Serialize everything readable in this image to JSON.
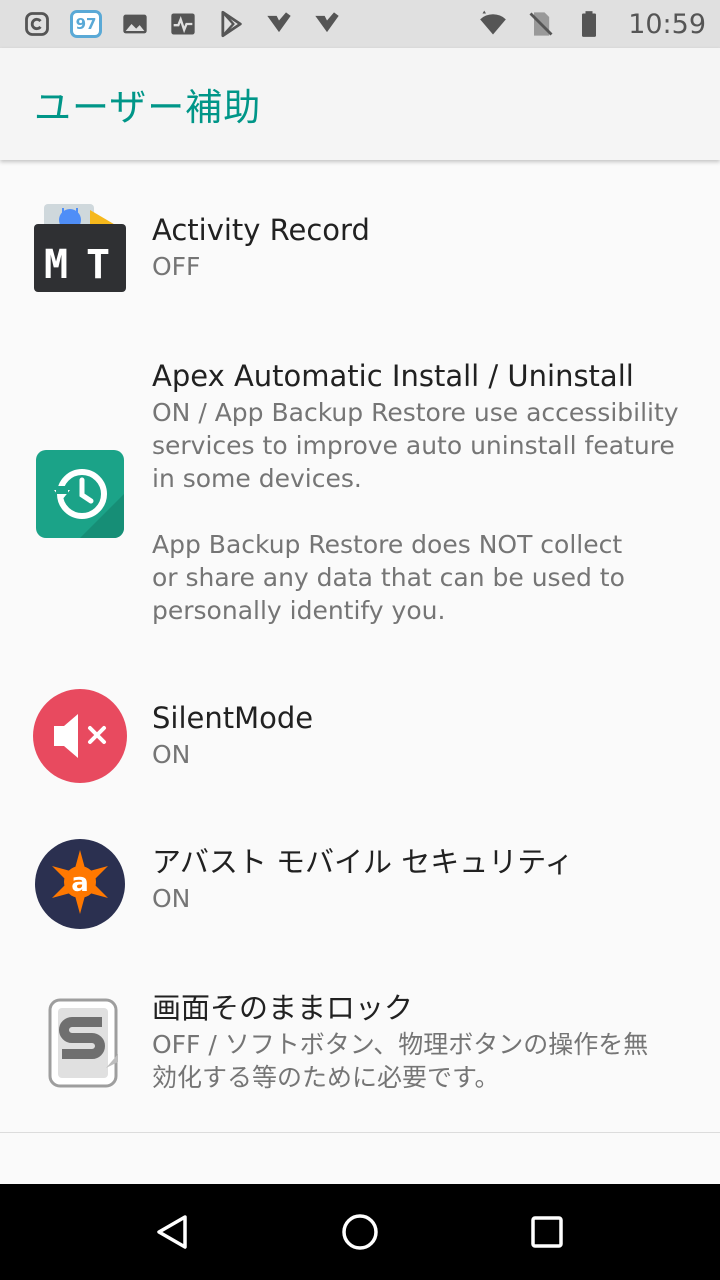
{
  "status_bar": {
    "time": "10:59",
    "badge": "97",
    "icons": [
      "app-notify-icon",
      "notification-badge-icon",
      "image-icon",
      "activity-icon",
      "play-store-icon",
      "check-icon",
      "check-icon",
      "wifi-icon",
      "no-sim-icon",
      "battery-icon"
    ]
  },
  "app_bar": {
    "title": "ユーザー補助"
  },
  "items": [
    {
      "title": "Activity Record",
      "summary": "OFF",
      "icon": "mt-manager-icon"
    },
    {
      "title": "Apex Automatic Install / Uninstall",
      "summary_lines": [
        "ON / App Backup Restore use accessibility\nservices to improve auto uninstall feature\nin some devices.",
        "App Backup Restore does NOT collect\nor share any data that can be used to\npersonally identify you."
      ],
      "icon": "backup-restore-icon"
    },
    {
      "title": "SilentMode",
      "summary": "ON",
      "icon": "silent-mode-icon"
    },
    {
      "title": "アバスト モバイル セキュリティ",
      "summary": "ON",
      "icon": "avast-icon"
    },
    {
      "title": "画面そのままロック",
      "summary": "OFF / ソフトボタン、物理ボタンの操作を無\n効化する等のために必要です。",
      "icon": "screen-lock-icon"
    }
  ],
  "colors": {
    "accent": "#009688",
    "status_bar_bg": "#e0e0e0",
    "silent_red": "#e84a5f",
    "avast_navy": "#2b3050",
    "avast_orange": "#ff7800",
    "backup_teal": "#1ba388"
  }
}
